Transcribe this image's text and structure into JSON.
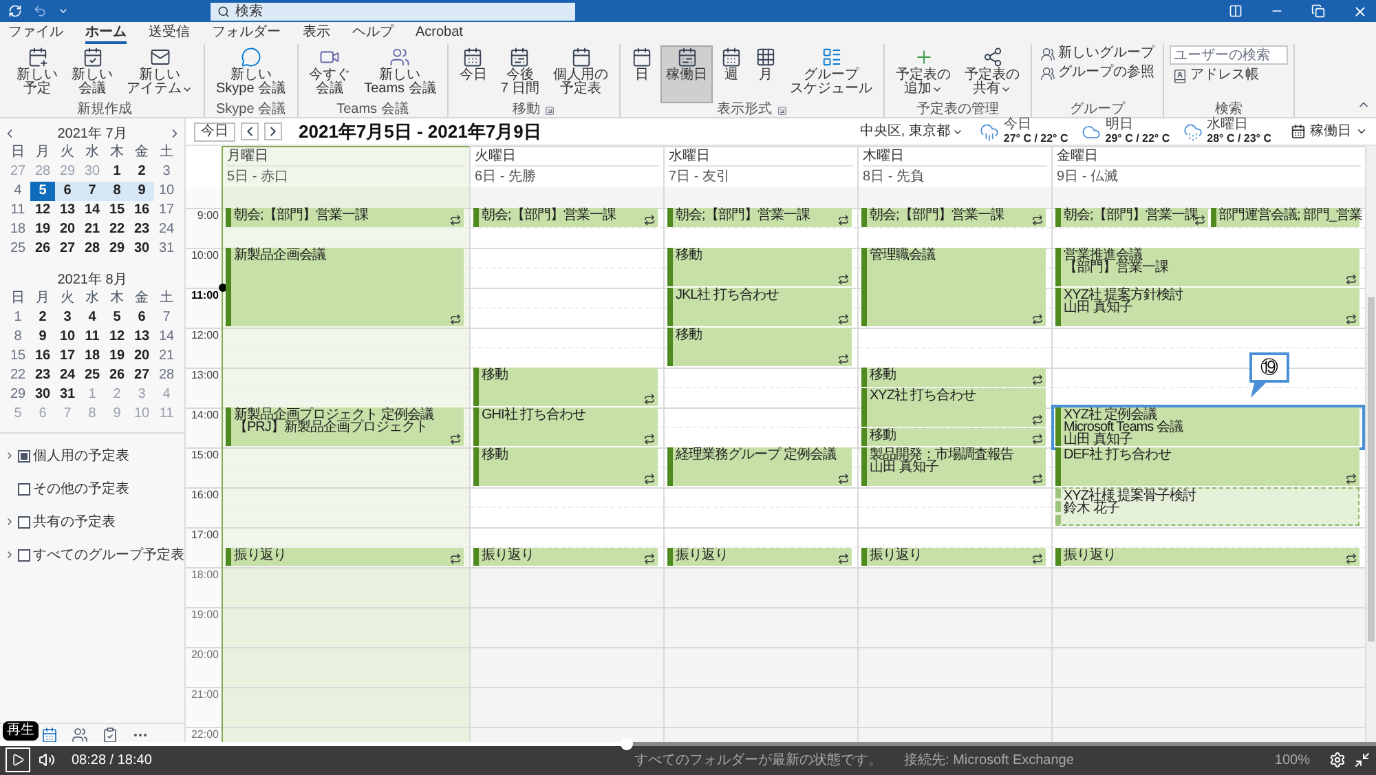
{
  "title_bar": {
    "search": {
      "placeholder": "検索"
    }
  },
  "tabs": [
    {
      "label": "ファイル",
      "selected": false
    },
    {
      "label": "ホーム",
      "selected": true
    },
    {
      "label": "送受信",
      "selected": false
    },
    {
      "label": "フォルダー",
      "selected": false
    },
    {
      "label": "表示",
      "selected": false
    },
    {
      "label": "ヘルプ",
      "selected": false
    },
    {
      "label": "Acrobat",
      "selected": false
    }
  ],
  "ribbon": {
    "groups": [
      {
        "label": "新規作成",
        "launcher": false,
        "buttons": [
          {
            "kind": "large",
            "lines": [
              "新しい",
              "予定"
            ],
            "dropdown": false
          },
          {
            "kind": "large",
            "lines": [
              "新しい",
              "会議"
            ],
            "dropdown": false
          },
          {
            "kind": "large",
            "lines": [
              "新しい",
              "アイテム"
            ],
            "dropdown": true
          }
        ]
      },
      {
        "label": "Skype 会議",
        "launcher": false,
        "buttons": [
          {
            "kind": "large",
            "lines": [
              "新しい",
              "Skype 会議"
            ],
            "dropdown": false
          }
        ]
      },
      {
        "label": "Teams 会議",
        "launcher": false,
        "buttons": [
          {
            "kind": "large",
            "lines": [
              "今すぐ",
              "会議"
            ],
            "dropdown": false
          },
          {
            "kind": "large",
            "lines": [
              "新しい",
              "Teams 会議"
            ],
            "dropdown": false
          }
        ]
      },
      {
        "label": "移動",
        "launcher": true,
        "buttons": [
          {
            "kind": "large",
            "lines": [
              "今日"
            ],
            "dropdown": false
          },
          {
            "kind": "large",
            "lines": [
              "今後",
              "7 日間"
            ],
            "dropdown": false
          },
          {
            "kind": "large",
            "lines": [
              "個人用の",
              "予定表"
            ],
            "dropdown": false
          }
        ]
      },
      {
        "label": "表示形式",
        "launcher": true,
        "buttons": [
          {
            "kind": "view",
            "lines": [
              "日"
            ],
            "selected": false
          },
          {
            "kind": "view",
            "lines": [
              "稼働日"
            ],
            "selected": true
          },
          {
            "kind": "view",
            "lines": [
              "週"
            ],
            "selected": false
          },
          {
            "kind": "view",
            "lines": [
              "月"
            ],
            "selected": false
          },
          {
            "kind": "view",
            "lines": [
              "グループ",
              "スケジュール"
            ],
            "selected": false
          }
        ]
      },
      {
        "label": "予定表の管理",
        "launcher": false,
        "buttons": [
          {
            "kind": "large",
            "lines": [
              "予定表の",
              "追加"
            ],
            "dropdown": true
          },
          {
            "kind": "large",
            "lines": [
              "予定表の",
              "共有"
            ],
            "dropdown": true
          }
        ]
      },
      {
        "label": "グループ",
        "launcher": false,
        "buttons": [
          {
            "kind": "small",
            "lines": [
              "新しいグループ"
            ]
          },
          {
            "kind": "small",
            "lines": [
              "グループの参照"
            ]
          }
        ]
      },
      {
        "label": "検索",
        "launcher": false,
        "buttons": [
          {
            "kind": "field",
            "placeholder": "ユーザーの検索"
          },
          {
            "kind": "small",
            "lines": [
              "アドレス帳"
            ]
          }
        ]
      }
    ]
  },
  "mini_calendars": [
    {
      "title": "2021年 7月",
      "weekdays": [
        "日",
        "月",
        "火",
        "水",
        "木",
        "金",
        "土"
      ],
      "weeks": [
        [
          {
            "t": "27",
            "kind": "out"
          },
          {
            "t": "28",
            "kind": "out"
          },
          {
            "t": "29",
            "kind": "out"
          },
          {
            "t": "30",
            "kind": "out"
          },
          {
            "t": "1",
            "kind": "day"
          },
          {
            "t": "2",
            "kind": "day"
          },
          {
            "t": "3",
            "kind": "weekend"
          }
        ],
        [
          {
            "t": "4",
            "kind": "weekend"
          },
          {
            "t": "5",
            "kind": "selected"
          },
          {
            "t": "6",
            "kind": "range"
          },
          {
            "t": "7",
            "kind": "range"
          },
          {
            "t": "8",
            "kind": "range"
          },
          {
            "t": "9",
            "kind": "range"
          },
          {
            "t": "10",
            "kind": "weekend"
          }
        ],
        [
          {
            "t": "11",
            "kind": "weekend"
          },
          {
            "t": "12",
            "kind": "day"
          },
          {
            "t": "13",
            "kind": "day"
          },
          {
            "t": "14",
            "kind": "day"
          },
          {
            "t": "15",
            "kind": "day"
          },
          {
            "t": "16",
            "kind": "day"
          },
          {
            "t": "17",
            "kind": "weekend"
          }
        ],
        [
          {
            "t": "18",
            "kind": "weekend"
          },
          {
            "t": "19",
            "kind": "day"
          },
          {
            "t": "20",
            "kind": "day"
          },
          {
            "t": "21",
            "kind": "day"
          },
          {
            "t": "22",
            "kind": "day"
          },
          {
            "t": "23",
            "kind": "day"
          },
          {
            "t": "24",
            "kind": "weekend"
          }
        ],
        [
          {
            "t": "25",
            "kind": "weekend"
          },
          {
            "t": "26",
            "kind": "day"
          },
          {
            "t": "27",
            "kind": "day"
          },
          {
            "t": "28",
            "kind": "day"
          },
          {
            "t": "29",
            "kind": "day"
          },
          {
            "t": "30",
            "kind": "day"
          },
          {
            "t": "31",
            "kind": "weekend"
          }
        ]
      ]
    },
    {
      "title": "2021年 8月",
      "weekdays": [
        "日",
        "月",
        "火",
        "水",
        "木",
        "金",
        "土"
      ],
      "weeks": [
        [
          {
            "t": "1",
            "kind": "weekend"
          },
          {
            "t": "2",
            "kind": "day"
          },
          {
            "t": "3",
            "kind": "day"
          },
          {
            "t": "4",
            "kind": "day"
          },
          {
            "t": "5",
            "kind": "day"
          },
          {
            "t": "6",
            "kind": "day"
          },
          {
            "t": "7",
            "kind": "weekend"
          }
        ],
        [
          {
            "t": "8",
            "kind": "weekend"
          },
          {
            "t": "9",
            "kind": "day"
          },
          {
            "t": "10",
            "kind": "day"
          },
          {
            "t": "11",
            "kind": "day"
          },
          {
            "t": "12",
            "kind": "day"
          },
          {
            "t": "13",
            "kind": "day"
          },
          {
            "t": "14",
            "kind": "weekend"
          }
        ],
        [
          {
            "t": "15",
            "kind": "weekend"
          },
          {
            "t": "16",
            "kind": "day"
          },
          {
            "t": "17",
            "kind": "day"
          },
          {
            "t": "18",
            "kind": "day"
          },
          {
            "t": "19",
            "kind": "day"
          },
          {
            "t": "20",
            "kind": "day"
          },
          {
            "t": "21",
            "kind": "weekend"
          }
        ],
        [
          {
            "t": "22",
            "kind": "weekend"
          },
          {
            "t": "23",
            "kind": "day"
          },
          {
            "t": "24",
            "kind": "day"
          },
          {
            "t": "25",
            "kind": "day"
          },
          {
            "t": "26",
            "kind": "day"
          },
          {
            "t": "27",
            "kind": "day"
          },
          {
            "t": "28",
            "kind": "weekend"
          }
        ],
        [
          {
            "t": "29",
            "kind": "weekend"
          },
          {
            "t": "30",
            "kind": "day"
          },
          {
            "t": "31",
            "kind": "day"
          },
          {
            "t": "1",
            "kind": "out"
          },
          {
            "t": "2",
            "kind": "out"
          },
          {
            "t": "3",
            "kind": "out"
          },
          {
            "t": "4",
            "kind": "out"
          }
        ],
        [
          {
            "t": "5",
            "kind": "out"
          },
          {
            "t": "6",
            "kind": "out"
          },
          {
            "t": "7",
            "kind": "out"
          },
          {
            "t": "8",
            "kind": "out"
          },
          {
            "t": "9",
            "kind": "out"
          },
          {
            "t": "10",
            "kind": "out"
          },
          {
            "t": "11",
            "kind": "out"
          }
        ]
      ]
    }
  ],
  "calendar_groups": [
    {
      "label": "個人用の予定表",
      "checked": true,
      "expandable": true
    },
    {
      "label": "その他の予定表",
      "checked": false,
      "expandable": false
    },
    {
      "label": "共有の予定表",
      "checked": false,
      "expandable": true
    },
    {
      "label": "すべてのグループ予定表",
      "checked": false,
      "expandable": true
    }
  ],
  "nav_items": [
    {
      "selected": true
    },
    {
      "selected": false
    },
    {
      "selected": false
    }
  ],
  "toolbar": {
    "today": "今日",
    "range": "2021年7月5日 - 2021年7月9日",
    "location": "中央区, 東京都",
    "weather": [
      {
        "day": "今日",
        "temp": "27° C / 22° C"
      },
      {
        "day": "明日",
        "temp": "29° C / 22° C"
      },
      {
        "day": "水曜日",
        "temp": "28° C / 23° C"
      }
    ],
    "view": "稼働日"
  },
  "hours": [
    {
      "label": "9:00",
      "working": true,
      "current": false
    },
    {
      "label": "10:00",
      "working": true,
      "current": false
    },
    {
      "label": "11:00",
      "working": true,
      "current": true
    },
    {
      "label": "12:00",
      "working": true,
      "current": false
    },
    {
      "label": "13:00",
      "working": true,
      "current": false
    },
    {
      "label": "14:00",
      "working": true,
      "current": false
    },
    {
      "label": "15:00",
      "working": true,
      "current": false
    },
    {
      "label": "16:00",
      "working": true,
      "current": false
    },
    {
      "label": "17:00",
      "working": true,
      "current": false
    },
    {
      "label": "18:00",
      "working": false,
      "current": false
    },
    {
      "label": "19:00",
      "working": false,
      "current": false
    },
    {
      "label": "20:00",
      "working": false,
      "current": false
    },
    {
      "label": "21:00",
      "working": false,
      "current": false
    },
    {
      "label": "22:00",
      "working": false,
      "current": false
    }
  ],
  "days": [
    {
      "name": "月曜日",
      "date": "5日 - 赤口",
      "selected": true,
      "slots": [
        {
          "kind": "free"
        },
        {
          "kind": "busy",
          "lines": [
            "朝会;【部門】営業一課"
          ],
          "recurring": true
        },
        {
          "kind": "free"
        },
        {
          "kind": "busy",
          "lines": [
            "新製品企画会議"
          ],
          "recurring": true
        },
        {
          "kind": "cont"
        },
        {
          "kind": "cont"
        },
        {
          "kind": "cont"
        },
        {
          "kind": "free"
        },
        {
          "kind": "free"
        },
        {
          "kind": "free"
        },
        {
          "kind": "free"
        },
        {
          "kind": "busy",
          "lines": [
            "新製品企画プロジェクト 定例会議",
            "【PRJ】新製品企画プロジェクト"
          ],
          "recurring": true
        },
        {
          "kind": "cont"
        },
        {
          "kind": "free"
        },
        {
          "kind": "free"
        },
        {
          "kind": "free"
        },
        {
          "kind": "free"
        },
        {
          "kind": "free"
        },
        {
          "kind": "busy",
          "lines": [
            "振り返り"
          ],
          "recurring": true
        }
      ]
    },
    {
      "name": "火曜日",
      "date": "6日 - 先勝",
      "selected": false,
      "slots": [
        {
          "kind": "free"
        },
        {
          "kind": "busy",
          "lines": [
            "朝会;【部門】営業一課"
          ],
          "recurring": true
        },
        {
          "kind": "free"
        },
        {
          "kind": "free"
        },
        {
          "kind": "free"
        },
        {
          "kind": "free"
        },
        {
          "kind": "free"
        },
        {
          "kind": "free"
        },
        {
          "kind": "free"
        },
        {
          "kind": "busy",
          "lines": [
            "移動"
          ],
          "recurring": true
        },
        {
          "kind": "cont"
        },
        {
          "kind": "busy",
          "lines": [
            "GHI社 打ち合わせ"
          ],
          "recurring": true
        },
        {
          "kind": "cont"
        },
        {
          "kind": "busy",
          "lines": [
            "移動"
          ],
          "recurring": true
        },
        {
          "kind": "cont"
        },
        {
          "kind": "free"
        },
        {
          "kind": "free"
        },
        {
          "kind": "free"
        },
        {
          "kind": "busy",
          "lines": [
            "振り返り"
          ],
          "recurring": true
        }
      ]
    },
    {
      "name": "水曜日",
      "date": "7日 - 友引",
      "selected": false,
      "slots": [
        {
          "kind": "free"
        },
        {
          "kind": "busy",
          "lines": [
            "朝会;【部門】営業一課"
          ],
          "recurring": true
        },
        {
          "kind": "free"
        },
        {
          "kind": "busy",
          "lines": [
            "移動"
          ],
          "recurring": true
        },
        {
          "kind": "cont"
        },
        {
          "kind": "busy",
          "lines": [
            "JKL社 打ち合わせ"
          ],
          "recurring": true
        },
        {
          "kind": "cont"
        },
        {
          "kind": "busy",
          "lines": [
            "移動"
          ],
          "recurring": true
        },
        {
          "kind": "cont"
        },
        {
          "kind": "free"
        },
        {
          "kind": "free"
        },
        {
          "kind": "free"
        },
        {
          "kind": "free"
        },
        {
          "kind": "busy",
          "lines": [
            "経理業務グループ 定例会議"
          ],
          "recurring": true
        },
        {
          "kind": "cont"
        },
        {
          "kind": "free"
        },
        {
          "kind": "free"
        },
        {
          "kind": "free"
        },
        {
          "kind": "busy",
          "lines": [
            "振り返り"
          ],
          "recurring": true
        }
      ]
    },
    {
      "name": "木曜日",
      "date": "8日 - 先負",
      "selected": false,
      "slots": [
        {
          "kind": "free"
        },
        {
          "kind": "busy",
          "lines": [
            "朝会;【部門】営業一課"
          ],
          "recurring": true
        },
        {
          "kind": "free"
        },
        {
          "kind": "busy",
          "lines": [
            "管理職会議"
          ],
          "recurring": true
        },
        {
          "kind": "cont"
        },
        {
          "kind": "cont"
        },
        {
          "kind": "cont"
        },
        {
          "kind": "free"
        },
        {
          "kind": "free"
        },
        {
          "kind": "busy",
          "lines": [
            "移動"
          ],
          "recurring": true
        },
        {
          "kind": "busy",
          "lines": [
            "XYZ社 打ち合わせ"
          ],
          "recurring": true
        },
        {
          "kind": "cont"
        },
        {
          "kind": "busy",
          "lines": [
            "移動"
          ],
          "recurring": true
        },
        {
          "kind": "busy",
          "lines": [
            "製品開発：市場調査報告",
            "山田 真知子"
          ],
          "recurring": true
        },
        {
          "kind": "cont"
        },
        {
          "kind": "free"
        },
        {
          "kind": "free"
        },
        {
          "kind": "free"
        },
        {
          "kind": "busy",
          "lines": [
            "振り返り"
          ],
          "recurring": true
        }
      ]
    },
    {
      "name": "金曜日",
      "date": "9日 - 仏滅",
      "selected": false,
      "slots": [
        {
          "kind": "free"
        },
        {
          "kind": "split",
          "events": [
            {
              "kind": "busy",
              "lines": [
                "朝会;【部門】営業一課"
              ],
              "recurring": true
            },
            {
              "kind": "busy",
              "lines": [
                "部門運営会議; 部門_営業"
              ],
              "recurring": false
            }
          ]
        },
        {
          "kind": "free"
        },
        {
          "kind": "busy",
          "lines": [
            "営業推進会議",
            "【部門】営業一課"
          ],
          "recurring": true
        },
        {
          "kind": "cont"
        },
        {
          "kind": "busy",
          "lines": [
            "XYZ社 提案方針検討",
            "山田 真知子"
          ],
          "recurring": true
        },
        {
          "kind": "cont"
        },
        {
          "kind": "free"
        },
        {
          "kind": "free"
        },
        {
          "kind": "free"
        },
        {
          "kind": "free"
        },
        {
          "kind": "busy",
          "lines": [
            "XYZ社 定例会議",
            "Microsoft Teams 会議",
            "山田 真知子"
          ],
          "recurring": false,
          "callout": "⑲"
        },
        {
          "kind": "cont"
        },
        {
          "kind": "busy",
          "lines": [
            "DEF社 打ち合わせ"
          ],
          "recurring": true
        },
        {
          "kind": "cont"
        },
        {
          "kind": "tentative",
          "lines": [
            "XYZ社様 提案骨子検討",
            "鈴木 花子"
          ],
          "recurring": false
        },
        {
          "kind": "cont"
        },
        {
          "kind": "free"
        },
        {
          "kind": "busy",
          "lines": [
            "振り返り"
          ],
          "recurring": true
        }
      ]
    }
  ],
  "player": {
    "tooltip": "再生",
    "time": "08:28 / 18:40",
    "level": 0.455
  },
  "status_bar": {
    "sync": "すべてのフォルダーが最新の状態です。",
    "connection": "接続先: Microsoft Exchange",
    "zoom": "100%"
  }
}
